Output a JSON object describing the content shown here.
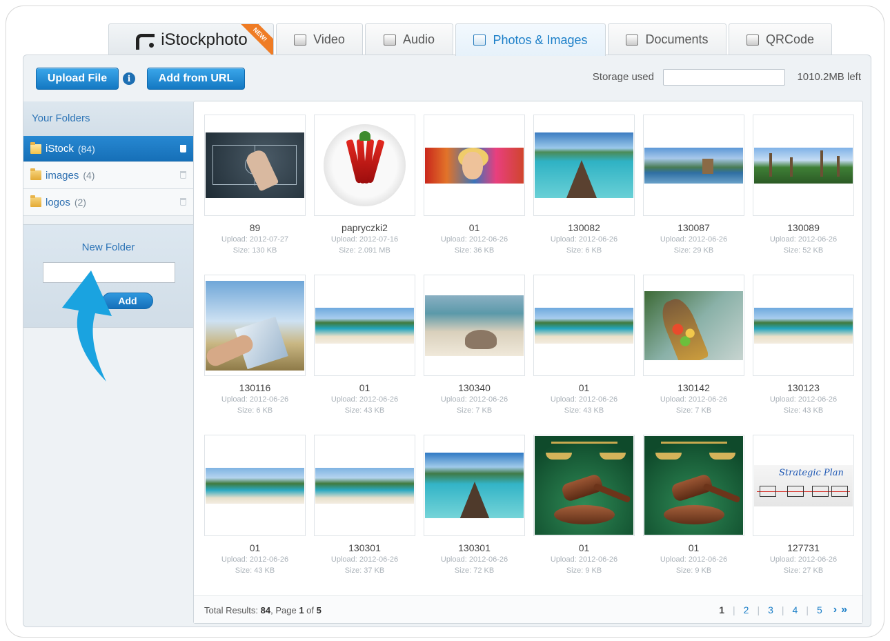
{
  "tabs": [
    {
      "label": "iStockphoto",
      "badge": "NEW!",
      "icon": "istockphoto-logo-icon"
    },
    {
      "label": "Video",
      "icon": "video-icon"
    },
    {
      "label": "Audio",
      "icon": "audio-icon"
    },
    {
      "label": "Photos & Images",
      "icon": "photos-icon",
      "active": true
    },
    {
      "label": "Documents",
      "icon": "documents-icon"
    },
    {
      "label": "QRCode",
      "icon": "qrcode-icon"
    }
  ],
  "toolbar": {
    "upload_label": "Upload File",
    "info_symbol": "i",
    "add_url_label": "Add from URL",
    "storage_label": "Storage used",
    "storage_left": "1010.2MB left"
  },
  "sidebar": {
    "title": "Your Folders",
    "folders": [
      {
        "name": "iStock",
        "count": "(84)",
        "selected": true
      },
      {
        "name": "images",
        "count": "(4)"
      },
      {
        "name": "logos",
        "count": "(2)"
      }
    ],
    "new_folder_title": "New Folder",
    "new_folder_value": "",
    "add_label": "Add"
  },
  "items": [
    {
      "title": "89",
      "upload": "Upload: 2012-07-27",
      "size": "Size: 130 KB"
    },
    {
      "title": "papryczki2",
      "upload": "Upload: 2012-07-16",
      "size": "Size: 2.091 MB"
    },
    {
      "title": "01",
      "upload": "Upload: 2012-06-26",
      "size": "Size: 36 KB"
    },
    {
      "title": "130082",
      "upload": "Upload: 2012-06-26",
      "size": "Size: 6 KB"
    },
    {
      "title": "130087",
      "upload": "Upload: 2012-06-26",
      "size": "Size: 29 KB"
    },
    {
      "title": "130089",
      "upload": "Upload: 2012-06-26",
      "size": "Size: 52 KB"
    },
    {
      "title": "130116",
      "upload": "Upload: 2012-06-26",
      "size": "Size: 6 KB"
    },
    {
      "title": "01",
      "upload": "Upload: 2012-06-26",
      "size": "Size: 43 KB"
    },
    {
      "title": "130340",
      "upload": "Upload: 2012-06-26",
      "size": "Size: 7 KB"
    },
    {
      "title": "01",
      "upload": "Upload: 2012-06-26",
      "size": "Size: 43 KB"
    },
    {
      "title": "130142",
      "upload": "Upload: 2012-06-26",
      "size": "Size: 7 KB"
    },
    {
      "title": "130123",
      "upload": "Upload: 2012-06-26",
      "size": "Size: 43 KB"
    },
    {
      "title": "01",
      "upload": "Upload: 2012-06-26",
      "size": "Size: 43 KB"
    },
    {
      "title": "130301",
      "upload": "Upload: 2012-06-26",
      "size": "Size: 37 KB"
    },
    {
      "title": "130301",
      "upload": "Upload: 2012-06-26",
      "size": "Size: 72 KB"
    },
    {
      "title": "01",
      "upload": "Upload: 2012-06-26",
      "size": "Size: 9 KB"
    },
    {
      "title": "01",
      "upload": "Upload: 2012-06-26",
      "size": "Size: 9 KB"
    },
    {
      "title": "127731",
      "upload": "Upload: 2012-06-26",
      "size": "Size: 27 KB"
    }
  ],
  "thumbnails": {
    "board_text": "Strategic Plan"
  },
  "footer": {
    "results_prefix": "Total Results: ",
    "results_total": "84",
    "results_page_prefix": ", Page ",
    "results_page": "1",
    "results_of": " of ",
    "results_pages": "5",
    "pages": [
      "1",
      "2",
      "3",
      "4",
      "5"
    ],
    "next_symbol": "›",
    "last_symbol": "»"
  },
  "colors": {
    "accent": "#1c7fc8",
    "button": "#1a83cf",
    "arrow": "#1aa3e0",
    "new_badge": "#ef7c25"
  }
}
